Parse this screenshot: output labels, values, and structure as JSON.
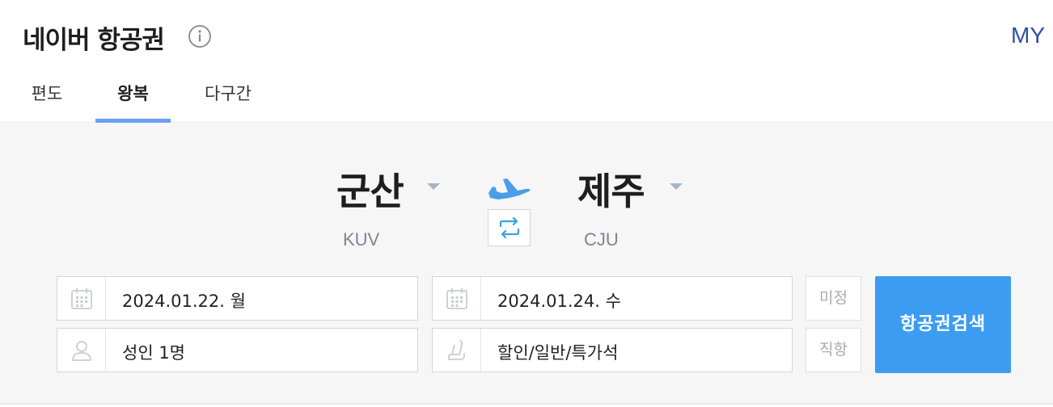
{
  "header": {
    "title": "네이버 항공권",
    "my_label": "MY"
  },
  "tabs": [
    {
      "label": "편도",
      "active": false
    },
    {
      "label": "왕복",
      "active": true
    },
    {
      "label": "다구간",
      "active": false
    }
  ],
  "route": {
    "origin": {
      "city": "군산",
      "code": "KUV"
    },
    "destination": {
      "city": "제주",
      "code": "CJU"
    }
  },
  "fields": {
    "depart_date": "2024.01.22. 월",
    "return_date": "2024.01.24. 수",
    "passengers": "성인 1명",
    "seat_class": "할인/일반/특가석",
    "undecided_label": "미정",
    "direct_label": "직항"
  },
  "search_button": "항공권검색",
  "icons": {
    "info": "info-icon",
    "plane": "plane-icon",
    "swap": "swap-icon",
    "calendar": "calendar-icon",
    "person": "person-icon",
    "seat": "seat-icon"
  },
  "colors": {
    "accent": "#3c9cf2",
    "tab_underline": "#6d9ef2",
    "my_link": "#2d4fa5"
  }
}
